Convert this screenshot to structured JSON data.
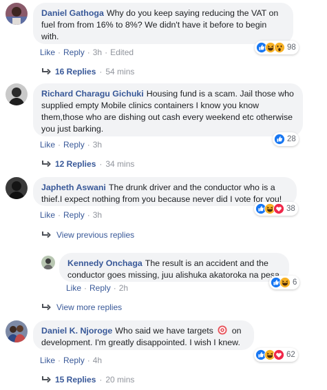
{
  "comments": [
    {
      "author": "Daniel Gathoga",
      "text": "Why do you keep saying reducing the VAT on fuel from from 16% to 8%? We didn't have it before to begin with.",
      "actions": {
        "like": "Like",
        "reply": "Reply",
        "time": "3h",
        "edited": "Edited"
      },
      "reactions": {
        "icons": [
          "like-icon",
          "haha-icon",
          "wow-icon"
        ],
        "count": "98"
      },
      "replies": {
        "label": "16 Replies",
        "time": "54 mins"
      }
    },
    {
      "author": "Richard Charagu Gichuki",
      "text": "Housing fund is a scam. Jail those who supplied empty Mobile clinics containers I know you know them,those who are dishing out cash every weekend etc otherwise you just barking.",
      "actions": {
        "like": "Like",
        "reply": "Reply",
        "time": "3h"
      },
      "reactions": {
        "icons": [
          "like-icon"
        ],
        "count": "28"
      },
      "replies": {
        "label": "12 Replies",
        "time": "34 mins"
      }
    },
    {
      "author": "Japheth Aswani",
      "text": "The drunk driver and the conductor who is a thief.I expect nothing from you because never did I vote for you!",
      "actions": {
        "like": "Like",
        "reply": "Reply",
        "time": "3h"
      },
      "reactions": {
        "icons": [
          "like-icon",
          "haha-icon",
          "love-icon"
        ],
        "count": "38"
      },
      "view_previous": "View previous replies",
      "reply": {
        "author": "Kennedy Onchaga",
        "text": "The result is an accident and the conductor goes missing, juu alishuka akatoroka na pesa",
        "actions": {
          "like": "Like",
          "reply": "Reply",
          "time": "2h"
        },
        "reactions": {
          "icons": [
            "like-icon",
            "haha-icon"
          ],
          "count": "6"
        }
      },
      "view_more": "View more replies"
    },
    {
      "author": "Daniel K. Njoroge",
      "text_before": "Who said we have targets",
      "emoji": "direct-hit-icon",
      "text_after": "on development. I'm greatly disappointed. I wish I knew.",
      "actions": {
        "like": "Like",
        "reply": "Reply",
        "time": "4h"
      },
      "reactions": {
        "icons": [
          "like-icon",
          "haha-icon",
          "love-icon"
        ],
        "count": "62"
      },
      "replies": {
        "label": "15 Replies",
        "time": "20 mins"
      }
    }
  ],
  "colors": {
    "link": "#385898",
    "bubble": "#f2f3f5",
    "like": "#1877f2",
    "love": "#f0284a",
    "haha": "#f7b125"
  }
}
